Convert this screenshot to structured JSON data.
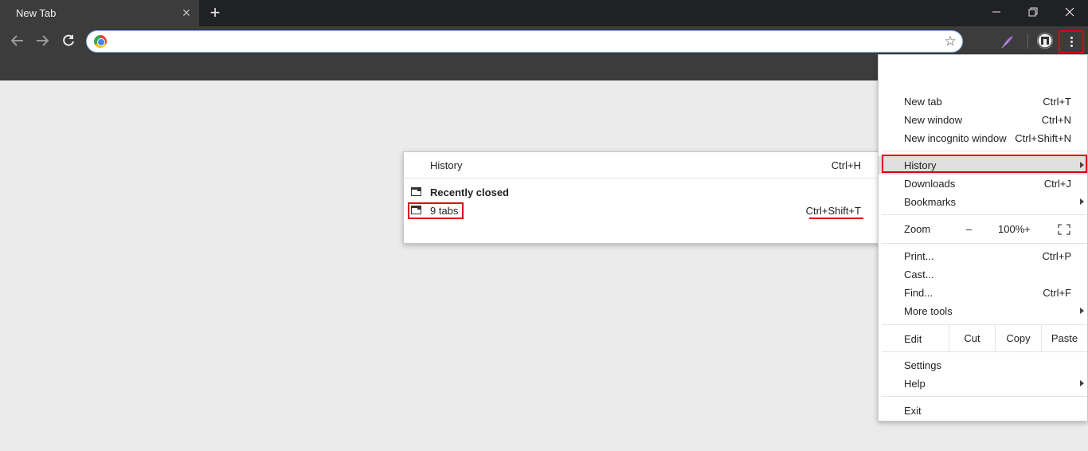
{
  "tab": {
    "title": "New Tab",
    "close": "✕"
  },
  "window": {
    "minimize": "—",
    "maximize": "❐",
    "close": "✕",
    "new_tab": "+"
  },
  "omnibox": {
    "value": "",
    "placeholder": ""
  },
  "submenu": {
    "history_label": "History",
    "history_shortcut": "Ctrl+H",
    "recently_closed": "Recently closed",
    "tabs_label": "9 tabs",
    "tabs_shortcut": "Ctrl+Shift+T"
  },
  "menu": {
    "new_tab": "New tab",
    "new_tab_shortcut": "Ctrl+T",
    "new_window": "New window",
    "new_window_shortcut": "Ctrl+N",
    "new_incognito": "New incognito window",
    "new_incognito_shortcut": "Ctrl+Shift+N",
    "history": "History",
    "downloads": "Downloads",
    "downloads_shortcut": "Ctrl+J",
    "bookmarks": "Bookmarks",
    "zoom": "Zoom",
    "zoom_minus": "–",
    "zoom_value": "100%",
    "zoom_plus": "+",
    "print": "Print...",
    "print_shortcut": "Ctrl+P",
    "cast": "Cast...",
    "find": "Find...",
    "find_shortcut": "Ctrl+F",
    "more_tools": "More tools",
    "edit": "Edit",
    "cut": "Cut",
    "copy": "Copy",
    "paste": "Paste",
    "settings": "Settings",
    "help": "Help",
    "exit": "Exit"
  },
  "colors": {
    "highlight": "#e0000f",
    "frame": "#3c3c3c",
    "titlebar": "#202124",
    "page": "#ebebeb"
  },
  "icons": [
    "back-arrow-icon",
    "forward-arrow-icon",
    "reload-icon",
    "chrome-logo-icon",
    "star-icon",
    "feather-extension-icon",
    "profile-icon",
    "more-vert-icon",
    "window-icon",
    "fullscreen-icon",
    "submenu-arrow-icon"
  ]
}
